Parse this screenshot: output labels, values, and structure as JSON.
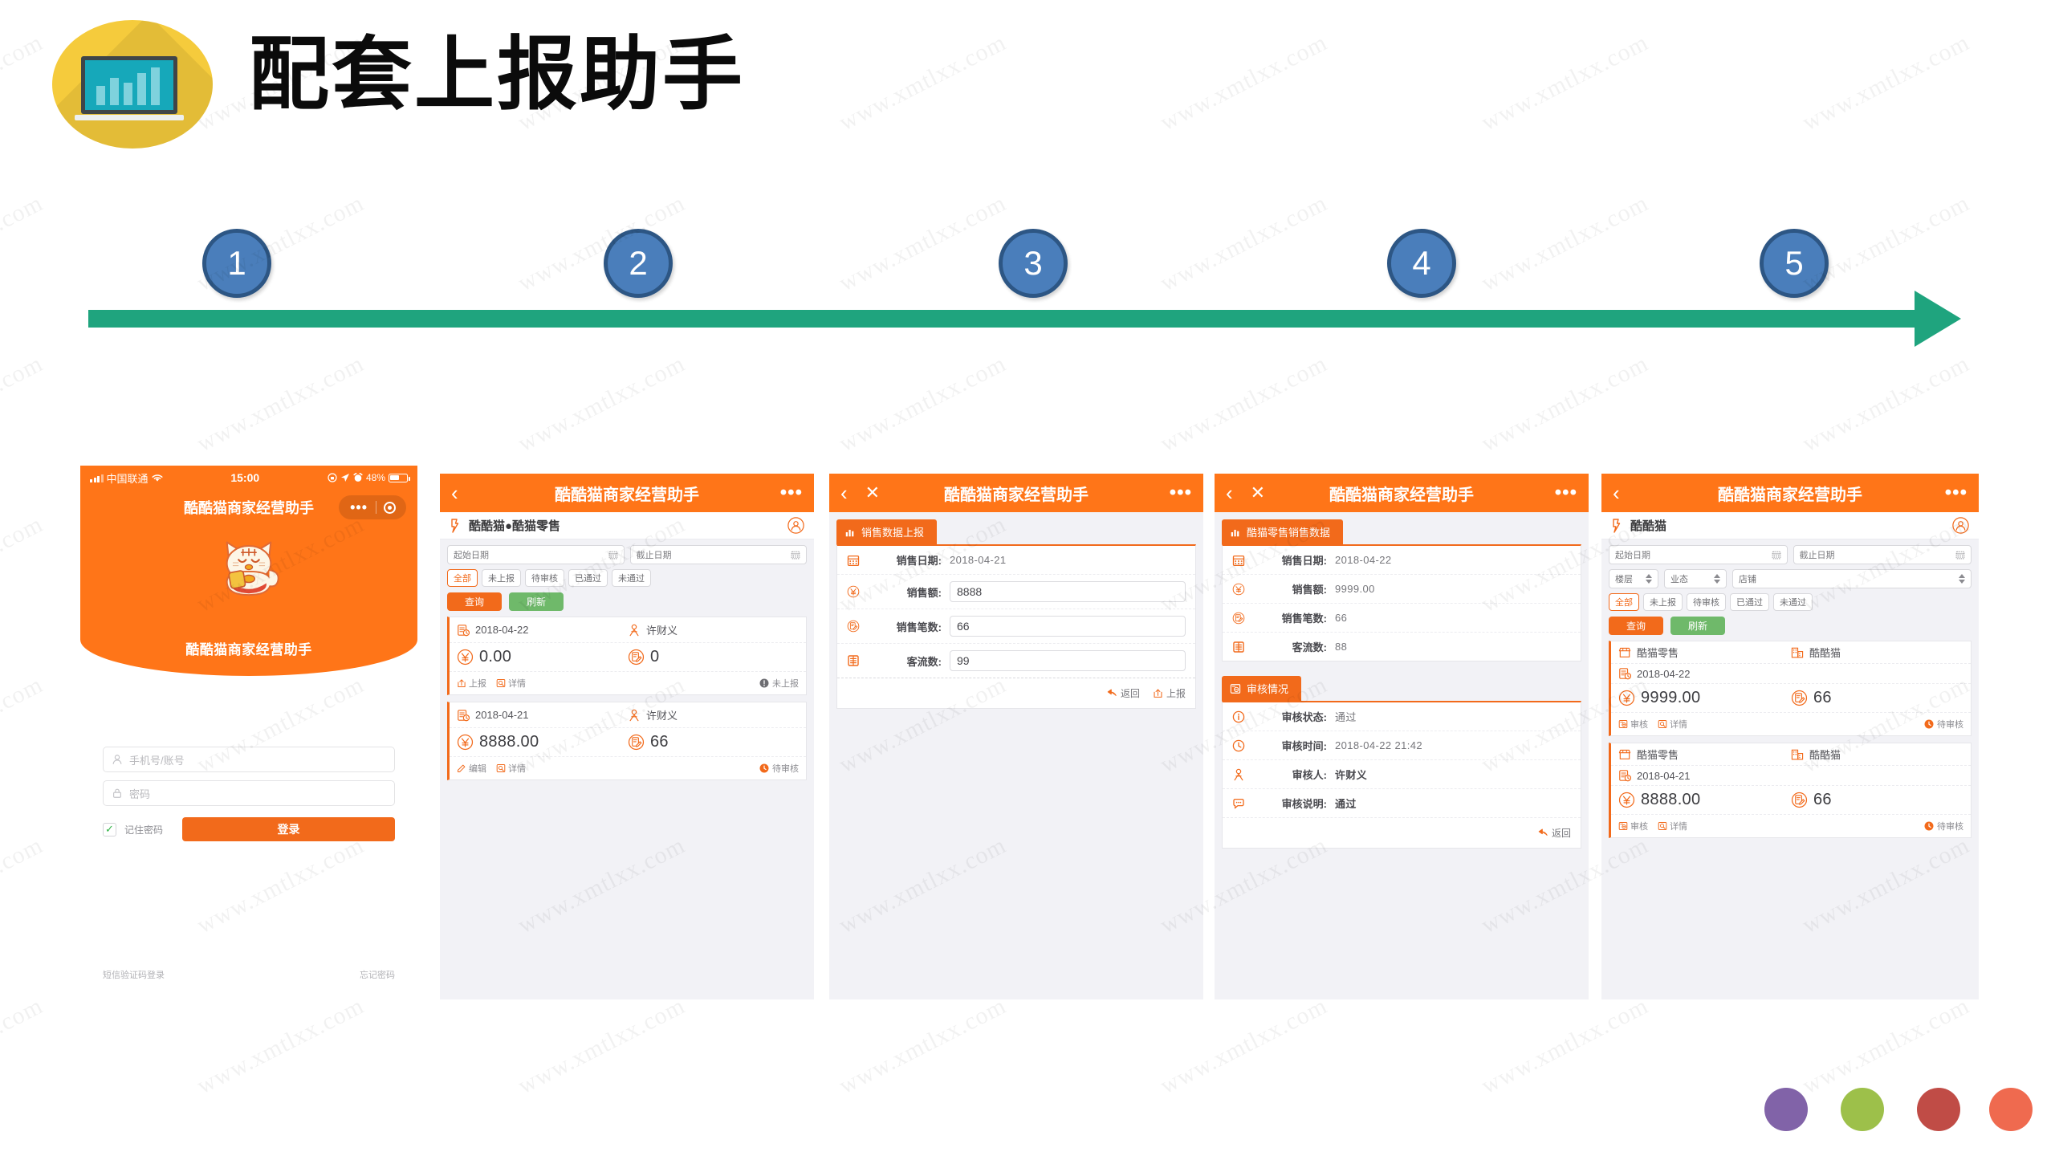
{
  "header": {
    "title": "配套上报助手",
    "logo_icon": "laptop-bar-chart-icon",
    "logo_circle_color": "#f5cb3c",
    "logo_screen_color": "#16a8ba"
  },
  "timeline": {
    "steps": [
      "1",
      "2",
      "3",
      "4",
      "5"
    ],
    "circle_color": "#4a7ebb",
    "circle_border_color": "#2d5684",
    "arrow_color": "#1fa47e"
  },
  "watermark": {
    "text": "www.xmtlxx.com"
  },
  "theme": {
    "orange": "#ff7518",
    "orange_dark": "#f26a1b",
    "green": "#6fb96a",
    "page_bg": "#f2f2f6"
  },
  "phone1": {
    "statusbar": {
      "carrier": "中国联通",
      "time": "15:00",
      "battery_percent": "48%",
      "wifi_icon": "wifi-icon",
      "signal_icon": "signal-bars-icon",
      "location_icon": "location-arrow-icon",
      "alarm_icon": "alarm-icon",
      "lock_icon": "rotation-lock-icon"
    },
    "nav_title": "酷酷猫商家经营助手",
    "capsule": {
      "dots_icon": "more-dots-icon",
      "circle_icon": "target-circle-icon"
    },
    "hero": {
      "cat_icon": "lucky-cat-icon",
      "label": "酷酷猫商家经营助手"
    },
    "fields": [
      {
        "icon": "user-icon",
        "placeholder": "手机号/账号"
      },
      {
        "icon": "lock-icon",
        "placeholder": "密码"
      }
    ],
    "remember_label": "记住密码",
    "remember_checked": true,
    "login_button": "登录",
    "links": {
      "sms": "短信验证码登录",
      "forgot": "忘记密码"
    }
  },
  "phone2": {
    "nav": {
      "back_icon": "chevron-left-icon",
      "title": "酷酷猫商家经营助手",
      "dots_icon": "more-dots-icon"
    },
    "shop_bar": {
      "tag_icon": "tag-icon",
      "name": "酷酷猫●酷猫零售",
      "avatar_icon": "user-circle-icon"
    },
    "date_from": {
      "placeholder": "起始日期",
      "icon": "calendar-icon"
    },
    "date_to": {
      "placeholder": "截止日期",
      "icon": "calendar-icon"
    },
    "status_chips": [
      "全部",
      "未上报",
      "待审核",
      "已通过",
      "未通过"
    ],
    "status_active_index": 0,
    "buttons": {
      "query": "查询",
      "refresh": "刷新"
    },
    "records": [
      {
        "date": "2018-04-22",
        "date_icon": "clipboard-clock-icon",
        "person": "许财义",
        "person_icon": "person-icon",
        "amount": "0.00",
        "amount_icon": "yuan-circle-icon",
        "count": "0",
        "count_icon": "report-circle-icon",
        "actions": [
          {
            "label": "上报",
            "icon": "upload-icon"
          },
          {
            "label": "详情",
            "icon": "detail-icon"
          }
        ],
        "status": "未上报",
        "status_icon": "exclamation-gray-icon"
      },
      {
        "date": "2018-04-21",
        "date_icon": "clipboard-clock-icon",
        "person": "许财义",
        "person_icon": "person-icon",
        "amount": "8888.00",
        "amount_icon": "yuan-circle-icon",
        "count": "66",
        "count_icon": "report-circle-icon",
        "actions": [
          {
            "label": "编辑",
            "icon": "edit-icon"
          },
          {
            "label": "详情",
            "icon": "detail-icon"
          }
        ],
        "status": "待审核",
        "status_icon": "clock-orange-icon"
      }
    ]
  },
  "phone3": {
    "nav": {
      "back_icon": "chevron-left-icon",
      "close_icon": "close-icon",
      "title": "酷酷猫商家经营助手",
      "dots_icon": "more-dots-icon"
    },
    "panel_title": "销售数据上报",
    "panel_icon": "bar-chart-icon",
    "rows": [
      {
        "icon": "calendar-icon",
        "label": "销售日期:",
        "value": "2018-04-21",
        "type": "text"
      },
      {
        "icon": "yuan-circle-icon",
        "label": "销售额:",
        "value": "8888",
        "type": "input"
      },
      {
        "icon": "report-circle-icon",
        "label": "销售笔数:",
        "value": "66",
        "type": "input"
      },
      {
        "icon": "calendar-day-icon",
        "label": "客流数:",
        "value": "99",
        "type": "input"
      }
    ],
    "buttons": [
      {
        "label": "返回",
        "icon": "back-arrow-icon"
      },
      {
        "label": "上报",
        "icon": "upload-icon"
      }
    ]
  },
  "phone4": {
    "nav": {
      "back_icon": "chevron-left-icon",
      "close_icon": "close-icon",
      "title": "酷酷猫商家经营助手",
      "dots_icon": "more-dots-icon"
    },
    "panel1": {
      "title": "酷猫零售销售数据",
      "icon": "bar-chart-icon",
      "rows": [
        {
          "icon": "calendar-icon",
          "label": "销售日期:",
          "value": "2018-04-22"
        },
        {
          "icon": "yuan-circle-icon",
          "label": "销售额:",
          "value": "9999.00"
        },
        {
          "icon": "report-circle-icon",
          "label": "销售笔数:",
          "value": "66"
        },
        {
          "icon": "calendar-day-icon",
          "label": "客流数:",
          "value": "88"
        }
      ]
    },
    "panel2": {
      "title": "审核情况",
      "icon": "review-icon",
      "rows": [
        {
          "icon": "info-circle-icon",
          "label": "审核状态:",
          "value": "通过",
          "bold": false
        },
        {
          "icon": "clock-icon",
          "label": "审核时间:",
          "value": "2018-04-22 21:42",
          "bold": false
        },
        {
          "icon": "person-icon",
          "label": "审核人:",
          "value": "许财义",
          "bold": true
        },
        {
          "icon": "comment-icon",
          "label": "审核说明:",
          "value": "通过",
          "bold": true
        }
      ],
      "buttons": [
        {
          "label": "返回",
          "icon": "back-arrow-icon"
        }
      ]
    }
  },
  "phone5": {
    "nav": {
      "back_icon": "chevron-left-icon",
      "title": "酷酷猫商家经营助手",
      "dots_icon": "more-dots-icon"
    },
    "shop_bar": {
      "tag_icon": "tag-icon",
      "name": "酷酷猫",
      "avatar_icon": "user-circle-icon"
    },
    "date_from": {
      "placeholder": "起始日期",
      "icon": "calendar-icon"
    },
    "date_to": {
      "placeholder": "截止日期",
      "icon": "calendar-icon"
    },
    "selects": [
      {
        "label": "楼层",
        "icon": "updown-arrow-icon"
      },
      {
        "label": "业态",
        "icon": "updown-arrow-icon"
      },
      {
        "label": "店铺",
        "icon": "updown-arrow-icon"
      }
    ],
    "status_chips": [
      "全部",
      "未上报",
      "待审核",
      "已通过",
      "未通过"
    ],
    "status_active_index": 0,
    "buttons": {
      "query": "查询",
      "refresh": "刷新"
    },
    "records": [
      {
        "shop": "酷猫零售",
        "shop_icon": "store-icon",
        "mall": "酷酷猫",
        "mall_icon": "building-icon",
        "date": "2018-04-22",
        "date_icon": "clipboard-clock-icon",
        "amount": "9999.00",
        "amount_icon": "yuan-circle-icon",
        "count": "66",
        "count_icon": "report-circle-icon",
        "actions": [
          {
            "label": "审核",
            "icon": "review-icon"
          },
          {
            "label": "详情",
            "icon": "detail-icon"
          }
        ],
        "status": "待审核",
        "status_icon": "clock-orange-icon"
      },
      {
        "shop": "酷猫零售",
        "shop_icon": "store-icon",
        "mall": "酷酷猫",
        "mall_icon": "building-icon",
        "date": "2018-04-21",
        "date_icon": "clipboard-clock-icon",
        "amount": "8888.00",
        "amount_icon": "yuan-circle-icon",
        "count": "66",
        "count_icon": "report-circle-icon",
        "actions": [
          {
            "label": "审核",
            "icon": "review-icon"
          },
          {
            "label": "详情",
            "icon": "detail-icon"
          }
        ],
        "status": "待审核",
        "status_icon": "clock-orange-icon"
      }
    ]
  },
  "bottom_dots": [
    {
      "color": "#8163a8"
    },
    {
      "color": "#9dc04a"
    },
    {
      "color": "#c04c46"
    },
    {
      "color": "#ef6a4f"
    }
  ]
}
